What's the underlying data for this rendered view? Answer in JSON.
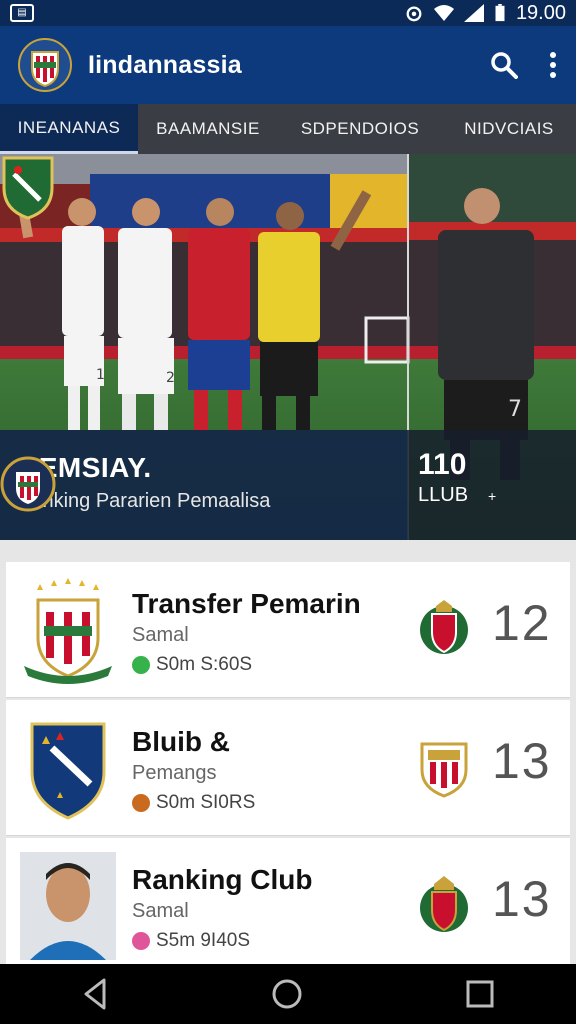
{
  "status_bar": {
    "time": "19.00"
  },
  "app": {
    "title": "Iindannassia"
  },
  "tabs": [
    {
      "label": "INEANANAS",
      "active": true
    },
    {
      "label": "BAAMANSIE",
      "active": false
    },
    {
      "label": "SDPENDOIOS",
      "active": false
    },
    {
      "label": "NIDVCIAIS",
      "active": false
    }
  ],
  "hero": {
    "title": "HEMSIAY.",
    "subtitle": "Panking Pararien Pemaalisa",
    "side_number": "110",
    "side_label": "LLUB",
    "side_mark": "+",
    "jersey_numbers": [
      "1",
      "2",
      "7"
    ]
  },
  "list": [
    {
      "title": "Transfer Pemarin",
      "subtitle": "Samal",
      "meta": "S0m S:60S",
      "rank": "12",
      "meta_color": "#35b34a"
    },
    {
      "title": "Bluib &",
      "subtitle": "Pemangs",
      "meta": "S0m SI0RS",
      "rank": "13",
      "meta_color": "#c96a1e"
    },
    {
      "title": "Ranking Club",
      "subtitle": "Samal",
      "meta": "S5m 9I40S",
      "rank": "13",
      "meta_color": "#e0559a"
    }
  ],
  "colors": {
    "appbar": "#0d3a7c",
    "tab_active": "#0c2a55",
    "tabs_bg": "#3a3d43"
  }
}
